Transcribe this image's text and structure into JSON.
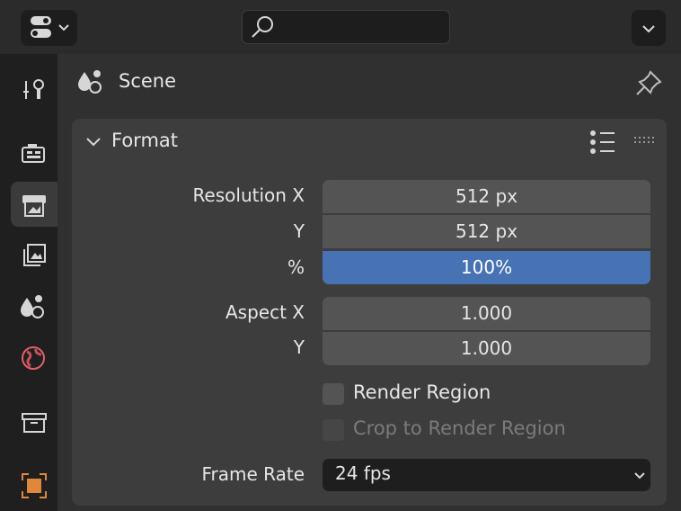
{
  "header": {
    "context_title": "Scene"
  },
  "panel": {
    "title": "Format",
    "resolution_x_label": "Resolution X",
    "resolution_x_value": "512 px",
    "resolution_y_label": "Y",
    "resolution_y_value": "512 px",
    "percent_label": "%",
    "percent_value": "100%",
    "aspect_x_label": "Aspect X",
    "aspect_x_value": "1.000",
    "aspect_y_label": "Y",
    "aspect_y_value": "1.000",
    "render_region_label": "Render Region",
    "crop_label": "Crop to Render Region",
    "frame_rate_label": "Frame Rate",
    "frame_rate_value": "24 fps"
  },
  "colors": {
    "accent": "#4772b3",
    "panel": "#3d3d3d",
    "field": "#545454"
  },
  "icons": [
    "editor-type-icon",
    "search-icon",
    "options-chevron-icon",
    "tool-icon",
    "render-icon",
    "output-icon",
    "view-layer-icon",
    "scene-icon",
    "world-icon",
    "collection-icon",
    "object-icon",
    "pin-icon"
  ]
}
